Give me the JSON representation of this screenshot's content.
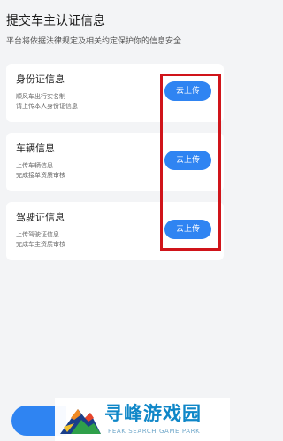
{
  "header": {
    "title": "提交车主认证信息",
    "subtitle": "平台将依据法律规定及相关约定保护你的信息安全"
  },
  "cards": [
    {
      "title": "身份证信息",
      "desc": [
        "顺风车出行实名制",
        "请上传本人身份证信息"
      ],
      "button_label": "去上传"
    },
    {
      "title": "车辆信息",
      "desc": [
        "上传车辆信息",
        "完成接单资质审核"
      ],
      "button_label": "去上传"
    },
    {
      "title": "驾驶证信息",
      "desc": [
        "上传驾驶证信息",
        "完成车主资质审核"
      ],
      "button_label": "去上传"
    }
  ],
  "watermark": {
    "cn": "寻峰游戏园",
    "en": "PEAK SEARCH GAME PARK"
  },
  "colors": {
    "accent": "#2f84f2",
    "highlight": "#d0141a",
    "background": "#f3f4f6",
    "card": "#ffffff"
  }
}
